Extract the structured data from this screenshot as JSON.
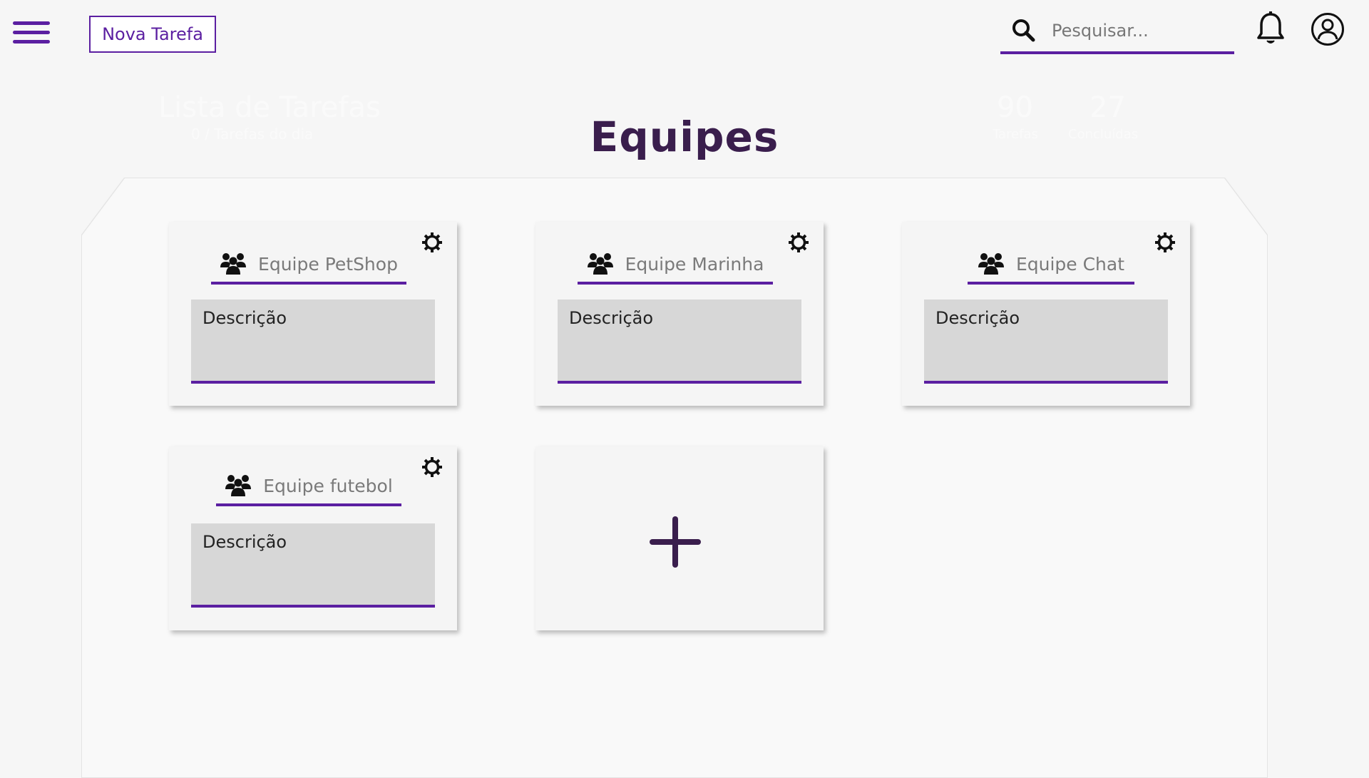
{
  "topbar": {
    "new_task_label": "Nova Tarefa",
    "search_placeholder": "Pesquisar..."
  },
  "background_header": {
    "title": "Lista de Tarefas",
    "subtitle": "0 / Tarefas do dia",
    "stat1_value": "90",
    "stat1_label": "Tarefas",
    "stat2_value": "27",
    "stat2_label": "Concluídas"
  },
  "page": {
    "title": "Equipes"
  },
  "teams": [
    {
      "name": "Equipe PetShop",
      "description": "Descrição"
    },
    {
      "name": "Equipe Marinha",
      "description": "Descrição"
    },
    {
      "name": "Equipe Chat",
      "description": "Descrição"
    },
    {
      "name": "Equipe futebol",
      "description": "Descrição"
    }
  ],
  "colors": {
    "accent": "#5b1fa1",
    "title": "#3a1e4d",
    "background": "#f6f6f6",
    "description_box": "#d7d7d7"
  }
}
